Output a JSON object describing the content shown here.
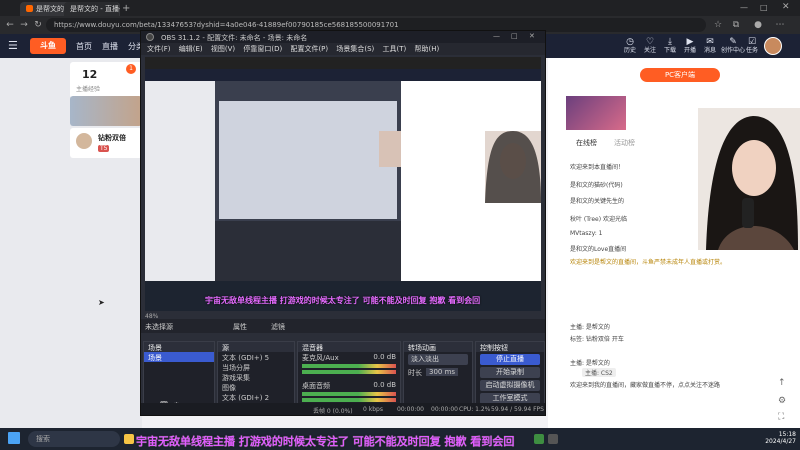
{
  "browser": {
    "tabs": [
      {
        "label": "是帮文的 - 直播_是帮文的 - 直播"
      },
      {
        "label": "是帮文的 - 直播_是帮文的 - 直播"
      }
    ],
    "url": "https://www.douyu.com/beta/13347653?dyshid=4a0e046-41889ef00790185ce568185500091701"
  },
  "site": {
    "logo": "斗鱼",
    "nav": [
      "首页",
      "直播",
      "分类"
    ],
    "icons": [
      {
        "icon": "history-icon",
        "label": "历史"
      },
      {
        "icon": "follow-icon",
        "label": "关注"
      },
      {
        "icon": "download-icon",
        "label": "下载"
      },
      {
        "icon": "live-icon",
        "label": "开播"
      },
      {
        "icon": "message-icon",
        "label": "消息"
      },
      {
        "icon": "creator-icon",
        "label": "创作中心"
      },
      {
        "icon": "task-icon",
        "label": "任务"
      }
    ],
    "left_stat_value": "12",
    "left_stat_label": "主播经验",
    "badge": "1",
    "pill_label": "PC客户端",
    "left_card_name": "钻粉双倍",
    "left_card_sub": "T5"
  },
  "obs": {
    "title": "OBS 31.1.2 - 配置文件: 未命名 - 场景: 未命名",
    "menu": [
      "文件(F)",
      "编辑(E)",
      "视图(V)",
      "停靠窗口(D)",
      "配置文件(P)",
      "场景集合(S)",
      "工具(T)",
      "帮助(H)"
    ],
    "preview_subtitle": "宇宙无敌单线程主播 打游戏的时候太专注了 可能不能及时回复 抱歉 看到会回",
    "src_bar": {
      "left": "48%",
      "sel_label": "未选择源",
      "props": "属性",
      "filters": "滤镜"
    },
    "docks": {
      "scenes": {
        "title": "场景",
        "items": [
          "场景"
        ]
      },
      "sources": {
        "title": "源",
        "items": [
          "文本 (GDI+) 5",
          "当场分屏",
          "游戏采集",
          "图像",
          "文本 (GDI+) 2"
        ]
      },
      "mixer": {
        "title": "混音器",
        "channels": [
          {
            "name": "麦克风/Aux",
            "db": "0.0 dB"
          },
          {
            "name": "桌面音频",
            "db": "0.0 dB"
          }
        ]
      },
      "transitions": {
        "title": "转场动画",
        "type": "淡入淡出",
        "duration_label": "时长",
        "duration": "300 ms"
      },
      "controls": {
        "title": "控制按钮",
        "buttons": [
          "停止直播",
          "开始录制",
          "启动虚拟摄像机",
          "工作室模式",
          "设置"
        ]
      }
    },
    "status": {
      "dropped": "丢帧 0 (0.0%)",
      "bitrate": "0 kbps",
      "rec_time": "00:00:00",
      "stream_time": "00:00:00",
      "cpu": "CPU: 1.2%",
      "fps": "59.94 / 59.94 FPS"
    }
  },
  "chat": {
    "tabs": [
      "在线榜",
      "活动榜"
    ],
    "lines": [
      "欢迎来到本直播间！",
      "是和文的猫砂(代码)",
      "是和文的关键先生的",
      "秋叶 (Tree) 欢迎光临",
      "MVtaszy: 1",
      "是和文的Love直播间",
      "欢迎来到是帮文的直播间，斗鱼严禁未成年人直播或打赏。",
      "主播: 是帮文的",
      "标签: 钻粉双倍 开车",
      "主播: 是帮文的",
      "欢迎来到我的直播间，藏家做直播不停，点点关注不迷路"
    ],
    "overlay_tag": "主播: CS2"
  },
  "caption": "宇宙无敌单线程主播 打游戏的时候太专注了 可能不能及时回复 抱歉 看到会回",
  "taskbar": {
    "search_placeholder": "搜索",
    "time": "15:18",
    "date": "2024/4/27"
  }
}
